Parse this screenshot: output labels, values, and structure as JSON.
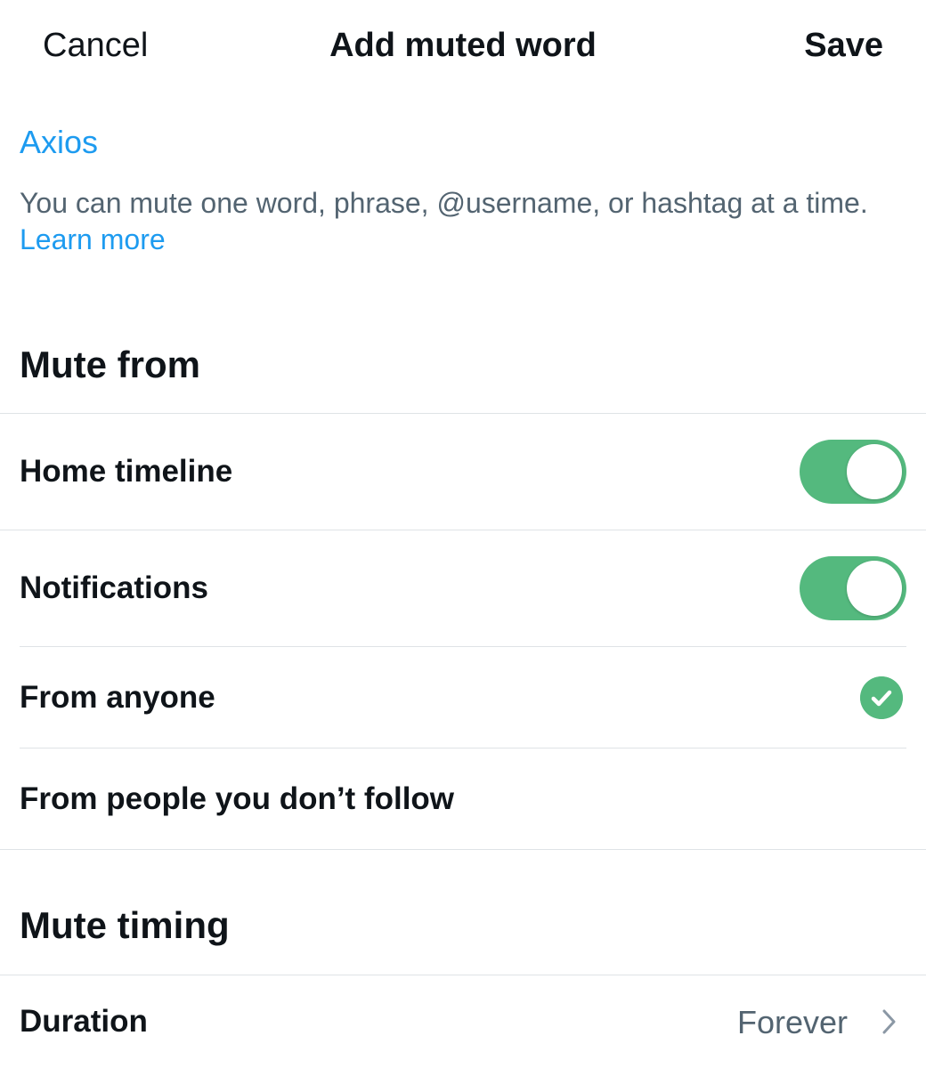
{
  "header": {
    "cancel_label": "Cancel",
    "title": "Add muted word",
    "save_label": "Save"
  },
  "word_input": {
    "value": "Axios"
  },
  "helper": {
    "text": "You can mute one word, phrase, @username, or hashtag at a time.",
    "learn_more": "Learn more"
  },
  "mute_from": {
    "title": "Mute from",
    "home_timeline": {
      "label": "Home timeline",
      "enabled": true
    },
    "notifications": {
      "label": "Notifications",
      "enabled": true
    },
    "from_anyone": {
      "label": "From anyone",
      "selected": true
    },
    "from_non_followers": {
      "label": "From people you don’t follow",
      "selected": false
    }
  },
  "mute_timing": {
    "title": "Mute timing",
    "duration_label": "Duration",
    "duration_value": "Forever"
  },
  "colors": {
    "accent": "#1d9bf0",
    "toggle_on": "#54b97e",
    "secondary_text": "#536471",
    "divider": "#dfe3e6"
  },
  "icons": {
    "check": "check-circle-icon",
    "chevron": "chevron-right-icon"
  }
}
